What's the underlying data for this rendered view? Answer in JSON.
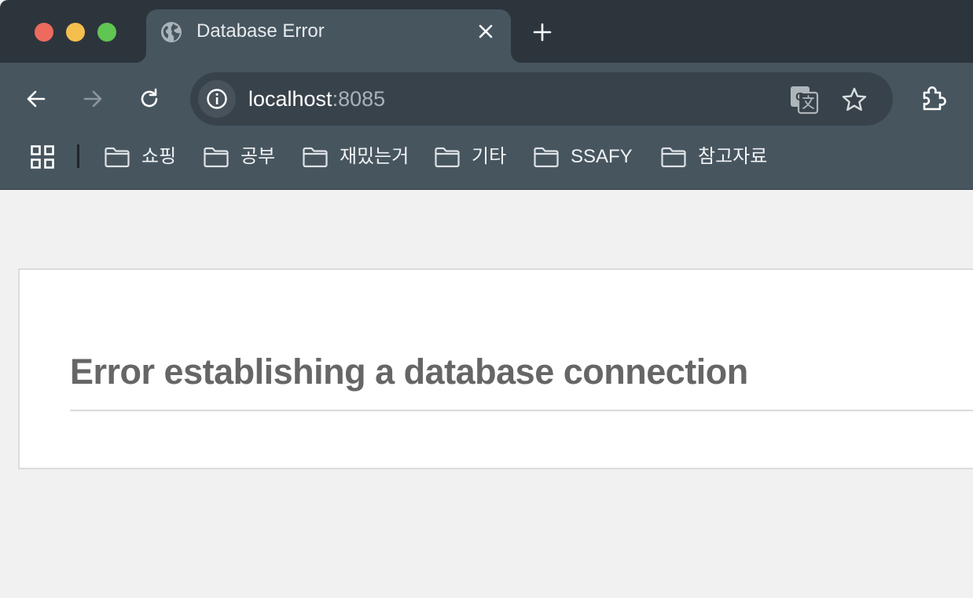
{
  "window": {
    "traffic_lights": {
      "close": "#ed6a5e",
      "minimize": "#f5bf4f",
      "maximize": "#61c554"
    }
  },
  "tab": {
    "title": "Database Error",
    "icon": "globe-icon"
  },
  "toolbar": {
    "back_icon": "arrow-left-icon",
    "forward_icon": "arrow-right-icon",
    "reload_icon": "reload-icon"
  },
  "address_bar": {
    "host": "localhost",
    "port": ":8085",
    "site_info_icon": "info-icon",
    "translate_icon": "translate-icon",
    "bookmark_icon": "star-icon"
  },
  "extensions_icon": "puzzle-icon",
  "bookmarks": {
    "apps_icon": "apps-grid-icon",
    "items": [
      {
        "label": "쇼핑",
        "icon": "folder-icon"
      },
      {
        "label": "공부",
        "icon": "folder-icon"
      },
      {
        "label": "재밌는거",
        "icon": "folder-icon"
      },
      {
        "label": "기타",
        "icon": "folder-icon"
      },
      {
        "label": "SSAFY",
        "icon": "folder-icon"
      },
      {
        "label": "참고자료",
        "icon": "folder-icon"
      }
    ]
  },
  "page": {
    "heading": "Error establishing a database connection"
  },
  "colors": {
    "tabstrip": "#2d353c",
    "toolbar": "#47555f",
    "omnibox": "#38424a",
    "page_background": "#f1f1f1",
    "heading_text": "#666666"
  }
}
